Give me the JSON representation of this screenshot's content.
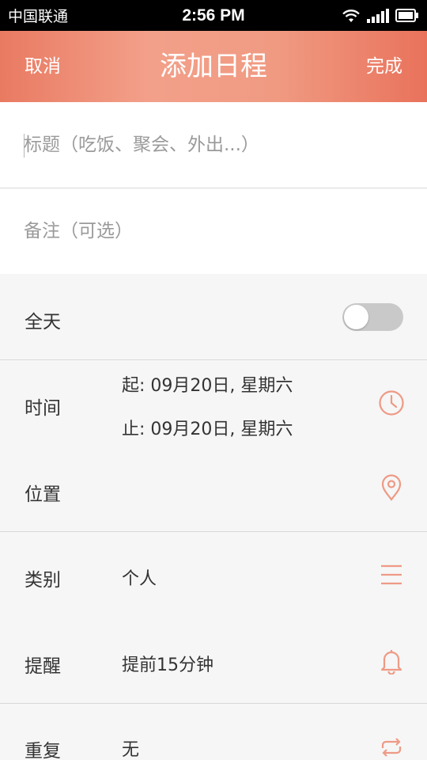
{
  "status_bar": {
    "carrier": "中国联通",
    "time": "2:56 PM"
  },
  "nav": {
    "cancel_label": "取消",
    "title": "添加日程",
    "done_label": "完成"
  },
  "form": {
    "title_placeholder": "标题（吃饭、聚会、外出...）",
    "title_value": "",
    "note_placeholder": "备注（可选）",
    "note_value": ""
  },
  "settings": {
    "all_day": {
      "label": "全天",
      "enabled": false
    },
    "time": {
      "label": "时间",
      "start": "起: 09月20日, 星期六",
      "end": "止: 09月20日, 星期六",
      "icon": "clock-icon"
    },
    "location": {
      "label": "位置",
      "value": "",
      "icon": "location-pin-icon"
    },
    "category": {
      "label": "类别",
      "value": "个人",
      "icon": "menu-list-icon"
    },
    "reminder": {
      "label": "提醒",
      "value": "提前15分钟",
      "icon": "bell-icon"
    },
    "repeat": {
      "label": "重复",
      "value": "无",
      "icon": "repeat-icon"
    }
  },
  "colors": {
    "accent": "#ec8a72",
    "icon": "#ee9a85"
  }
}
